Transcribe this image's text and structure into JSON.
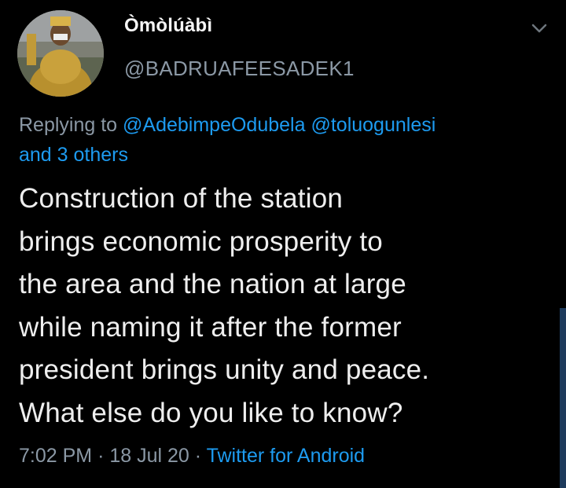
{
  "author": {
    "display_name": "Òmòlúàbì",
    "handle": "@BADRUAFEESADEK1",
    "avatar_icon": "profile-avatar"
  },
  "reply": {
    "prefix": "Replying to",
    "mention_1": "@AdebimpeOdubela",
    "mention_2": "@toluogunlesi",
    "others": "and 3 others"
  },
  "tweet": {
    "lines": [
      "Construction of the station",
      "brings economic prosperity to",
      "the area and the nation at large",
      "while naming it after the former",
      "president brings unity and peace.",
      "What else do you like to know?"
    ]
  },
  "meta": {
    "time": "7:02 PM",
    "sep": "·",
    "date": "18 Jul 20",
    "source": "Twitter for Android"
  },
  "icons": {
    "menu": "chevron-down-icon"
  },
  "colors": {
    "background": "#000000",
    "text": "#eeeeee",
    "secondary": "#8b98a5",
    "link": "#1d9bf0"
  }
}
